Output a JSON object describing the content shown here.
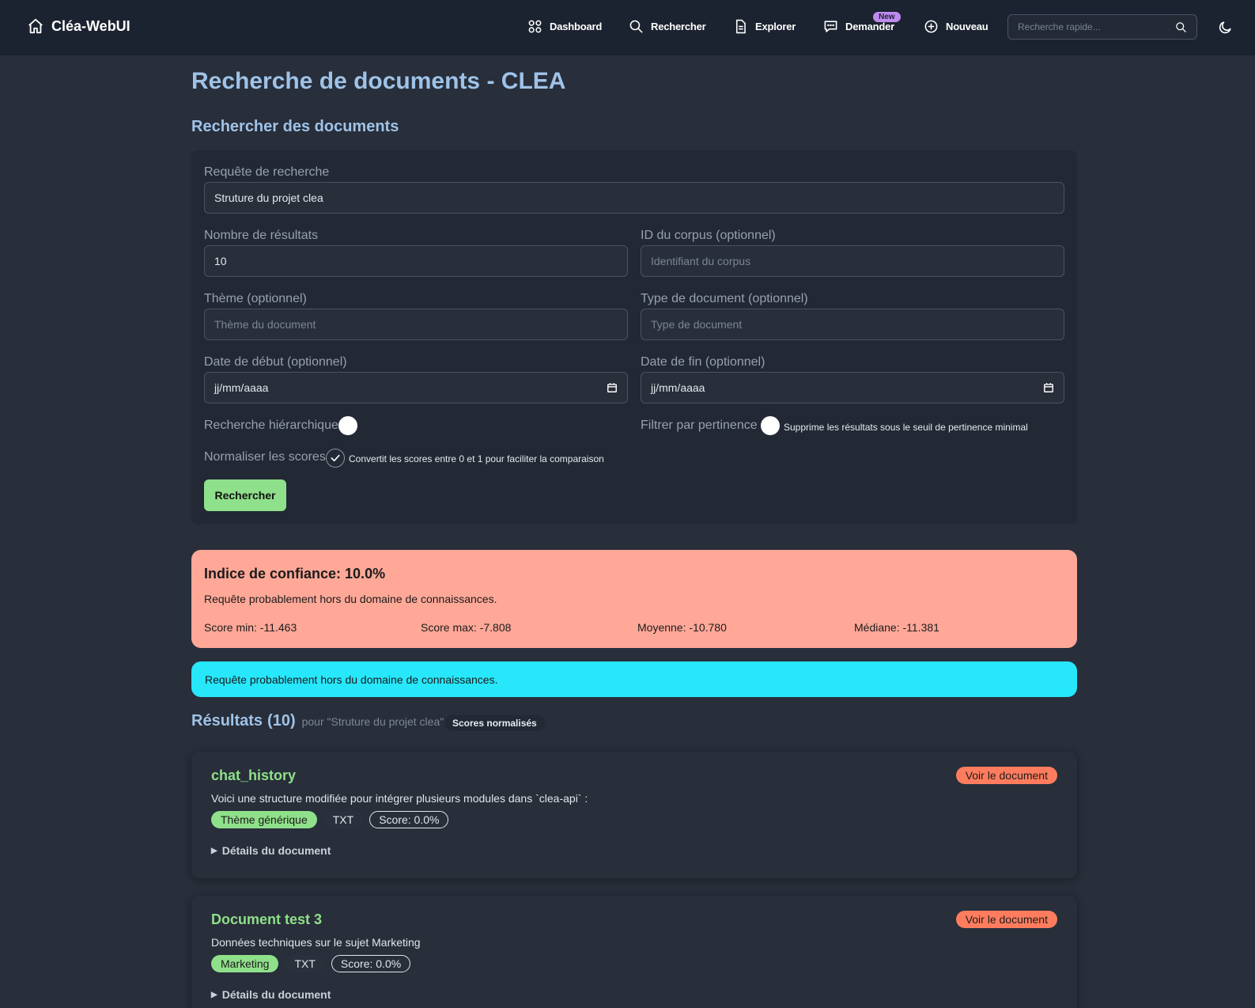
{
  "navbar": {
    "brand": "Cléa-WebUI",
    "items": [
      {
        "label": "Dashboard",
        "icon": "grid-icon"
      },
      {
        "label": "Rechercher",
        "icon": "search-icon"
      },
      {
        "label": "Explorer",
        "icon": "document-icon"
      },
      {
        "label": "Demander",
        "icon": "chat-icon"
      },
      {
        "label": "Nouveau",
        "icon": "plus-circle-icon"
      }
    ],
    "new_badge": "New",
    "quick_search_placeholder": "Recherche rapide..."
  },
  "page": {
    "title": "Recherche de documents - CLEA",
    "section_title": "Rechercher des documents"
  },
  "form": {
    "query_label": "Requête de recherche",
    "query_value": "Struture du projet clea",
    "nresults_label": "Nombre de résultats",
    "nresults_value": "10",
    "corpus_label": "ID du corpus (optionnel)",
    "corpus_placeholder": "Identifiant du corpus",
    "theme_label": "Thème (optionnel)",
    "theme_placeholder": "Thème du document",
    "doctype_label": "Type de document (optionnel)",
    "doctype_placeholder": "Type de document",
    "start_label": "Date de début (optionnel)",
    "start_value": "jj/mm/aaaa",
    "end_label": "Date de fin (optionnel)",
    "end_value": "jj/mm/aaaa",
    "hier_label": "Recherche hiérarchique",
    "filter_label": "Filtrer par pertinence",
    "filter_hint": "Supprime les résultats sous le seuil de pertinence minimal",
    "norm_label": "Normaliser les scores",
    "norm_hint": "Convertit les scores entre 0 et 1 pour faciliter la comparaison",
    "submit_label": "Rechercher"
  },
  "confidence": {
    "title": "Indice de confiance: 10.0%",
    "message": "Requête probablement hors du domaine de connaissances.",
    "min": "Score min: -11.463",
    "max": "Score max: -7.808",
    "mean": "Moyenne: -10.780",
    "median": "Médiane: -11.381"
  },
  "info_message": "Requête probablement hors du domaine de connaissances.",
  "results": {
    "title": "Résultats",
    "count": "(10)",
    "query_text": "pour \"Struture du projet clea\"",
    "badge": "Scores normalisés",
    "items": [
      {
        "title": "chat_history",
        "description": "Voici une structure modifiée pour intégrer plusieurs modules dans `clea-api` :",
        "theme": "Thème générique",
        "type": "TXT",
        "score": "Score: 0.0%",
        "view": "Voir le document",
        "details": "Détails du document"
      },
      {
        "title": "Document test 3",
        "description": "Données techniques sur le sujet Marketing",
        "theme": "Marketing",
        "type": "TXT",
        "score": "Score: 0.0%",
        "view": "Voir le document",
        "details": "Détails du document"
      }
    ]
  }
}
